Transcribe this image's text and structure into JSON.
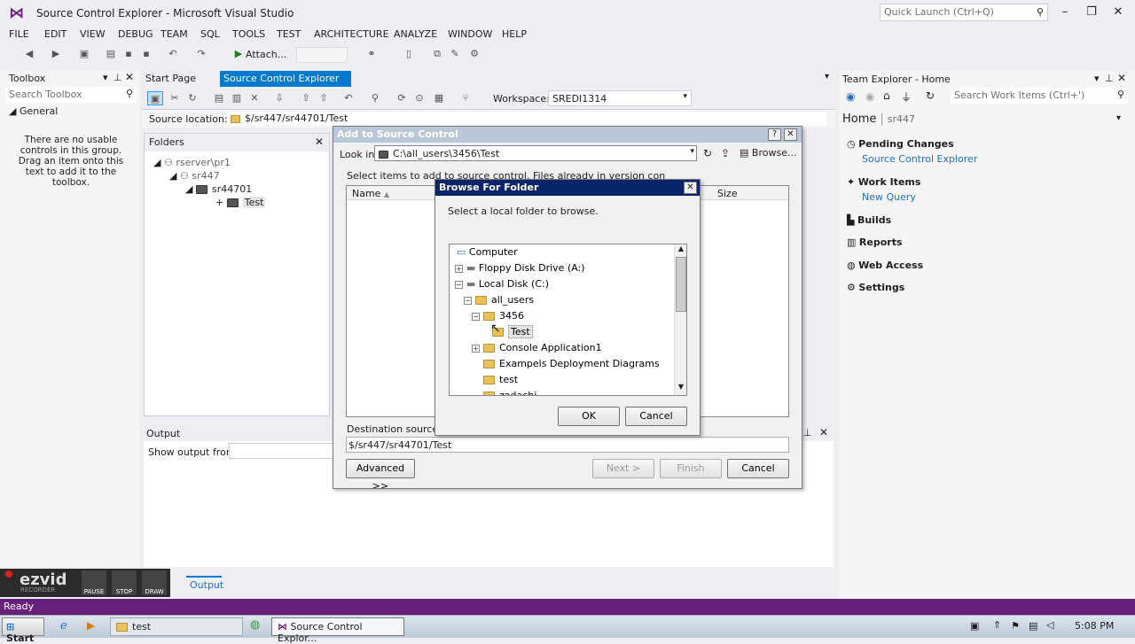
{
  "app": {
    "title": "Source Control Explorer - Microsoft Visual Studio",
    "quick_launch": "Quick Launch (Ctrl+Q)"
  },
  "menu": [
    "FILE",
    "EDIT",
    "VIEW",
    "DEBUG",
    "TEAM",
    "SQL",
    "TOOLS",
    "TEST",
    "ARCHITECTURE",
    "ANALYZE",
    "WINDOW",
    "HELP"
  ],
  "toolbar": {
    "attach": "Attach..."
  },
  "toolbox": {
    "title": "Toolbox",
    "search": "Search Toolbox",
    "group": "General",
    "empty": "There are no usable controls in this group. Drag an item onto this text to add it to the toolbox."
  },
  "tabs": {
    "start": "Start Page",
    "sce": "Source Control Explorer"
  },
  "sce": {
    "workspace_label": "Workspace:",
    "workspace": "SREDI1314",
    "source_location_label": "Source location:",
    "source_location": "$/sr447/sr44701/Test",
    "folders_title": "Folders",
    "tree": [
      "rserver\\pr1",
      "sr447",
      "sr44701",
      "Test"
    ]
  },
  "output": {
    "title": "Output",
    "show_from": "Show output from:",
    "tab": "Output"
  },
  "team_explorer": {
    "title": "Team Explorer - Home",
    "search": "Search Work Items (Ctrl+')",
    "home": "Home",
    "project": "sr447",
    "pending": "Pending Changes",
    "sce_link": "Source Control Explorer",
    "work_items": "Work Items",
    "new_query": "New Query",
    "builds": "Builds",
    "reports": "Reports",
    "web_access": "Web Access",
    "settings": "Settings"
  },
  "add_dialog": {
    "title": "Add to Source Control",
    "look_in_label": "Look in:",
    "look_in": "C:\\all_users\\3456\\Test",
    "browse": "Browse...",
    "hint": "Select items to add to source control. Files already in version control are hidden.",
    "col_name": "Name",
    "col_size": "Size",
    "dest_label": "Destination source co",
    "dest": "$/sr447/sr44701/Test",
    "advanced": "Advanced >>",
    "next": "Next >",
    "finish": "Finish",
    "cancel": "Cancel"
  },
  "browse_dialog": {
    "title": "Browse For Folder",
    "prompt": "Select a local folder to browse.",
    "ok": "OK",
    "cancel": "Cancel",
    "items": [
      "Computer",
      "Floppy Disk Drive (A:)",
      "Local Disk (C:)",
      "all_users",
      "3456",
      "Test",
      "Console Application1",
      "Exampels Deployment Diagrams",
      "test",
      "zadachi"
    ]
  },
  "ezvid": {
    "pause": "PAUSE",
    "stop": "STOP",
    "draw": "DRAW",
    "logo": "ezvid",
    "sub": "RECORDER"
  },
  "status": "Ready",
  "taskbar": {
    "start": "Start",
    "explorer": "test",
    "vs": "Source Control Explor...",
    "time": "5:08 PM"
  }
}
